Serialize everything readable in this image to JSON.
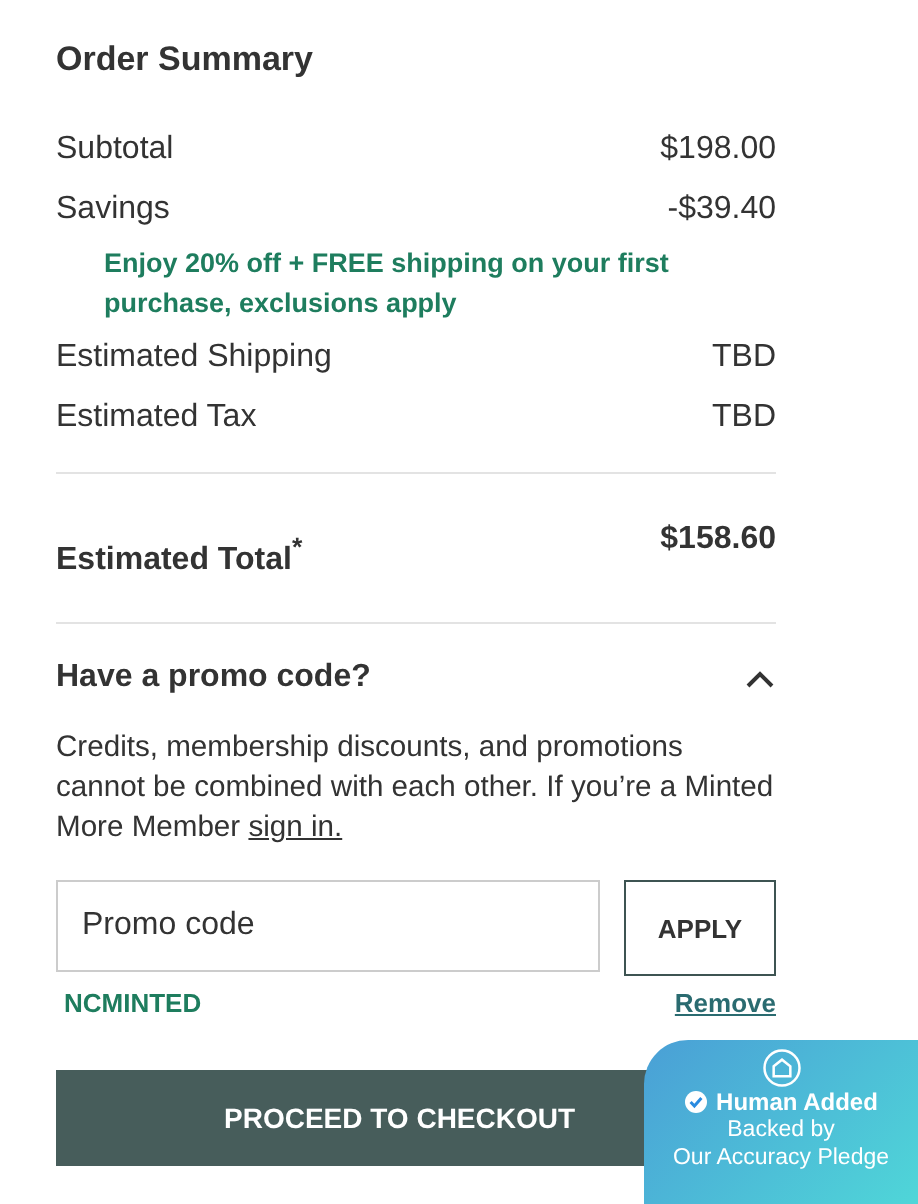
{
  "title": "Order Summary",
  "lines": [
    {
      "label": "Subtotal",
      "value": "$198.00"
    },
    {
      "label": "Savings",
      "value": "-$39.40"
    }
  ],
  "promo_note": "Enjoy 20% off + FREE shipping on your first purchase, exclusions apply",
  "estimates": [
    {
      "label": "Estimated Shipping",
      "value": "TBD"
    },
    {
      "label": "Estimated Tax",
      "value": "TBD"
    }
  ],
  "total": {
    "label": "Estimated Total$^{*}$",
    "value": "$158.60"
  },
  "promo": {
    "heading": "Have a promo code?",
    "expanded": true,
    "notice": "Credits, membership discounts, and promotions cannot be combined with each other. If you’re a Minted More Member",
    "link": "sign in.",
    "field": {
      "placeholder": "Promo code"
    },
    "apply": "APPLY",
    "applied_code": "NCMINTED",
    "remove": "Remove"
  },
  "checkout": "PROCEED TO CHECKOUT",
  "badge": {
    "title": "Human Added",
    "line_1": "Backed by",
    "line_2": "Our Accuracy Pledge"
  }
}
